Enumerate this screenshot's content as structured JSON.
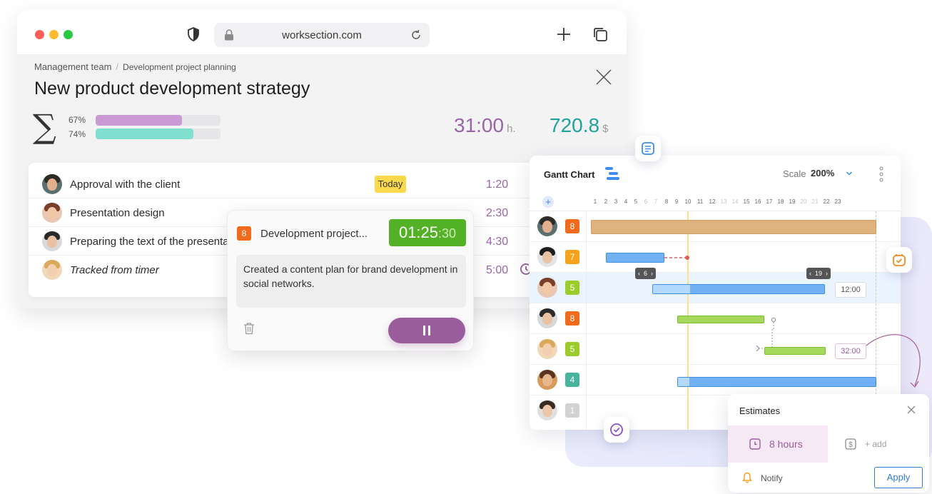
{
  "browser": {
    "url": "worksection.com",
    "breadcrumb": {
      "team": "Management team",
      "separator": "/",
      "project": "Development project planning"
    },
    "title": "New product development strategy",
    "progress": [
      {
        "label": "67%",
        "value": 67,
        "color": "#c99ad3"
      },
      {
        "label": "74%",
        "value": 74,
        "color": "#7fe0d0"
      }
    ],
    "totals": {
      "hours": "31:00",
      "hours_unit": "h.",
      "money": "720.8",
      "money_unit": "$"
    }
  },
  "tasks": [
    {
      "name": "Approval with the client",
      "badge": "Today",
      "time": "1:20"
    },
    {
      "name": "Presentation design",
      "badge": "",
      "time": "2:30"
    },
    {
      "name": "Preparing the text of the presenta",
      "badge": "",
      "time": "4:30"
    },
    {
      "name": "Tracked from timer",
      "badge": "",
      "time": "5:00"
    }
  ],
  "timer": {
    "number": "8",
    "task": "Development project...",
    "clock_main": "01:25",
    "clock_seconds": ":30",
    "note": "Created a content plan for brand development in social networks."
  },
  "gantt": {
    "title": "Gantt Chart",
    "scale_label": "Scale",
    "scale_value": "200%",
    "days": [
      "1",
      "2",
      "3",
      "4",
      "5",
      "6",
      "7",
      "8",
      "9",
      "10",
      "11",
      "12",
      "13",
      "14",
      "15",
      "16",
      "17",
      "18",
      "19",
      "20",
      "21",
      "22",
      "23"
    ],
    "weekend_days": [
      "6",
      "7",
      "13",
      "14",
      "20",
      "21"
    ],
    "rows": [
      {
        "number": "8",
        "color": "#f26a1b"
      },
      {
        "number": "7",
        "color": "#f6a21d"
      },
      {
        "number": "5",
        "color": "#9ccc2b"
      },
      {
        "number": "8",
        "color": "#f26a1b"
      },
      {
        "number": "5",
        "color": "#9ccc2b"
      },
      {
        "number": "4",
        "color": "#48b49e"
      },
      {
        "number": "1",
        "color": "#d2d2d2"
      }
    ],
    "pill_left": "6",
    "pill_right": "19",
    "tag_a": "12:00",
    "tag_b": "32:00"
  },
  "estimates": {
    "title": "Estimates",
    "hours": "8 hours",
    "add": "+ add",
    "notify": "Notify",
    "apply": "Apply"
  }
}
